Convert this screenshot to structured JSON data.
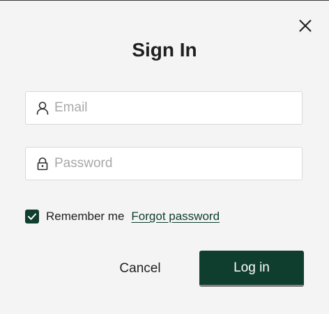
{
  "dialog": {
    "title": "Sign In"
  },
  "fields": {
    "email": {
      "value": "",
      "placeholder": "Email",
      "icon": "person-icon"
    },
    "password": {
      "value": "",
      "placeholder": "Password",
      "icon": "lock-icon"
    }
  },
  "remember": {
    "label": "Remember me",
    "checked": true
  },
  "links": {
    "forgot_password": "Forgot password"
  },
  "buttons": {
    "cancel": "Cancel",
    "login": "Log in",
    "close_icon": "close-icon"
  },
  "colors": {
    "accent": "#0f3d2e",
    "background": "#f4f4f4",
    "field_background": "#ffffff",
    "placeholder": "#a8a8a8",
    "text": "#1f1f1f"
  }
}
